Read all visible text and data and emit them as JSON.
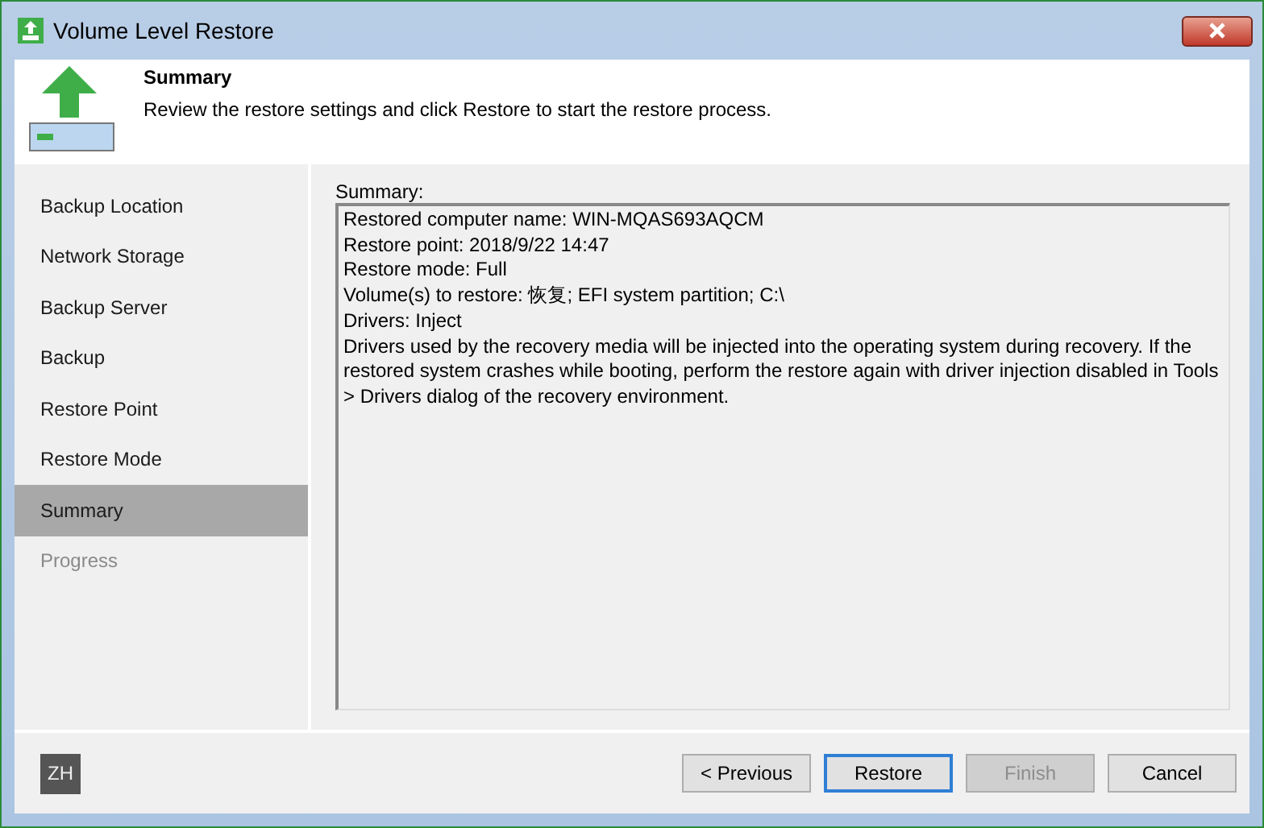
{
  "window": {
    "title": "Volume Level Restore"
  },
  "header": {
    "title": "Summary",
    "description": "Review the restore settings and click Restore to start the restore process."
  },
  "steps": [
    {
      "label": "Backup Location",
      "selected": false,
      "disabled": false
    },
    {
      "label": "Network Storage",
      "selected": false,
      "disabled": false
    },
    {
      "label": "Backup Server",
      "selected": false,
      "disabled": false
    },
    {
      "label": "Backup",
      "selected": false,
      "disabled": false
    },
    {
      "label": "Restore Point",
      "selected": false,
      "disabled": false
    },
    {
      "label": "Restore Mode",
      "selected": false,
      "disabled": false
    },
    {
      "label": "Summary",
      "selected": true,
      "disabled": false
    },
    {
      "label": "Progress",
      "selected": false,
      "disabled": true
    }
  ],
  "summary": {
    "label": "Summary:",
    "lines": [
      "Restored computer name: WIN-MQAS693AQCM",
      "Restore point: 2018/9/22 14:47",
      "Restore mode: Full",
      "Volume(s) to restore: 恢复; EFI system partition; C:\\",
      "Drivers: Inject",
      "Drivers used by the recovery media will be injected into the operating system during recovery. If the restored system crashes while booting, perform the restore again with driver injection disabled in Tools > Drivers dialog of the recovery environment."
    ]
  },
  "language": "ZH",
  "buttons": [
    {
      "label": "< Previous",
      "default": false,
      "disabled": false
    },
    {
      "label": "Restore",
      "default": true,
      "disabled": false
    },
    {
      "label": "Finish",
      "default": false,
      "disabled": true
    },
    {
      "label": "Cancel",
      "default": false,
      "disabled": false
    }
  ]
}
